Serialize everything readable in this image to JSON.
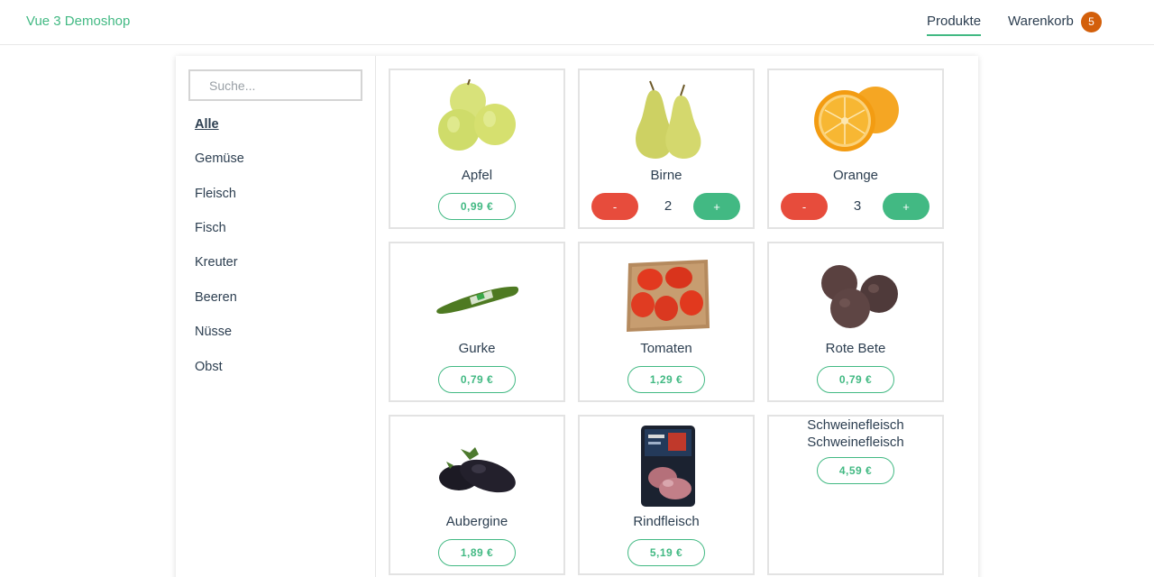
{
  "header": {
    "brand": "Vue 3 Demoshop",
    "nav_products": "Produkte",
    "nav_cart": "Warenkorb",
    "cart_count": "5"
  },
  "sidebar": {
    "search_placeholder": "Suche...",
    "categories": [
      {
        "label": "Alle",
        "active": true
      },
      {
        "label": "Gemüse"
      },
      {
        "label": "Fleisch"
      },
      {
        "label": "Fisch"
      },
      {
        "label": "Kreuter"
      },
      {
        "label": "Beeren"
      },
      {
        "label": "Nüsse"
      },
      {
        "label": "Obst"
      }
    ]
  },
  "products": [
    {
      "name": "Apfel",
      "price": "0,99 €",
      "image": "apple-image"
    },
    {
      "name": "Birne",
      "quantity": "2",
      "minus": "-",
      "plus": "+",
      "image": "pear-image"
    },
    {
      "name": "Orange",
      "quantity": "3",
      "minus": "-",
      "plus": "+",
      "image": "orange-image"
    },
    {
      "name": "Gurke",
      "price": "0,79 €",
      "image": "cucumber-image"
    },
    {
      "name": "Tomaten",
      "price": "1,29 €",
      "image": "tomato-tray-image"
    },
    {
      "name": "Rote Bete",
      "price": "0,79 €",
      "image": "beetroot-image"
    },
    {
      "name": "Aubergine",
      "price": "1,89 €",
      "image": "eggplant-image"
    },
    {
      "name": "Rindfleisch",
      "price": "5,19 €",
      "image": "beef-package-image"
    },
    {
      "name": "Schweinefleisch",
      "alt": "Schweinefleisch",
      "price": "4,59 €"
    }
  ],
  "colors": {
    "accent": "#42b983",
    "minus": "#e74c3c",
    "badge": "#d35f0a",
    "text": "#2c3e50"
  }
}
